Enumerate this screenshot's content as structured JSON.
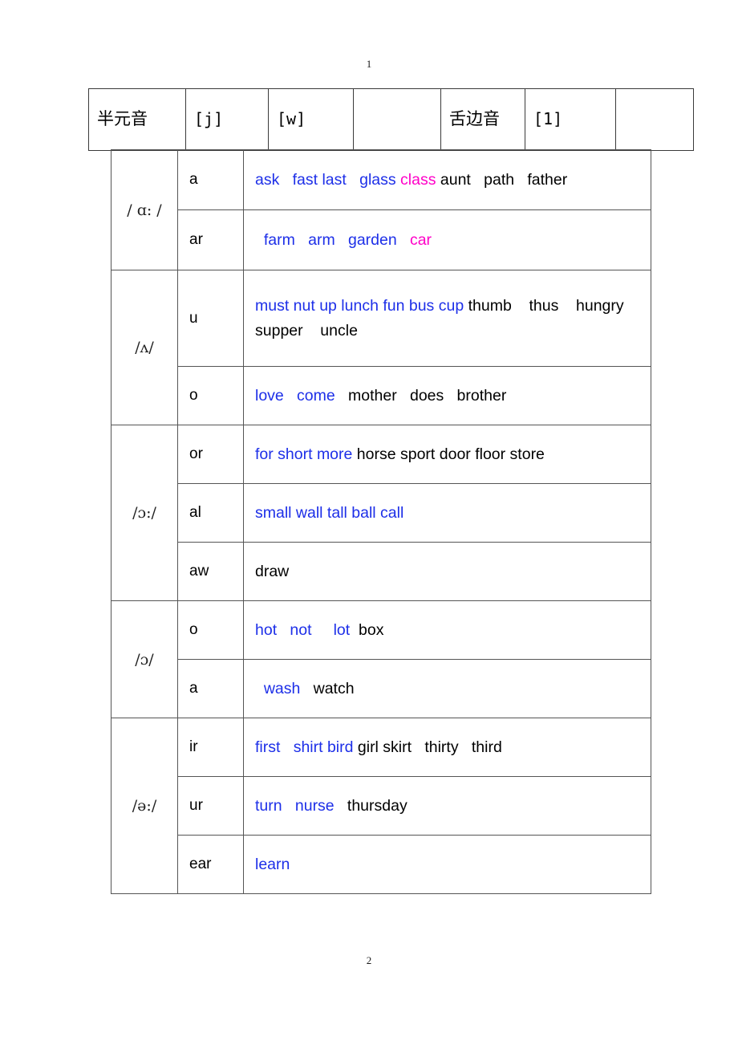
{
  "document": {
    "page_number_top": "1",
    "page_number_bottom": "2"
  },
  "colors": {
    "blue": "#1d2fe8",
    "magenta": "#ff00c8",
    "black": "#000000",
    "border": "#555555",
    "header_border": "#3a3a3a"
  },
  "consonant_header": {
    "cells": [
      {
        "text": "半元音",
        "style": "cjk"
      },
      {
        "text": "[j]",
        "style": "ipa"
      },
      {
        "text": "[w]",
        "style": "ipa"
      },
      {
        "text": "",
        "style": "blank"
      },
      {
        "text": "舌边音",
        "style": "cjk"
      },
      {
        "text": "[1]",
        "style": "ipa"
      },
      {
        "text": "",
        "style": "blank"
      }
    ]
  },
  "vowel_table": {
    "groups": [
      {
        "ipa": "/ ɑ: /",
        "rows": [
          {
            "spelling": "a",
            "words": [
              {
                "text": "ask",
                "color": "blue"
              },
              {
                "text": "   ",
                "color": "black"
              },
              {
                "text": "fast last",
                "color": "blue"
              },
              {
                "text": "   ",
                "color": "black"
              },
              {
                "text": "glass ",
                "color": "blue"
              },
              {
                "text": "class",
                "color": "magenta"
              },
              {
                "text": " aunt",
                "color": "black"
              },
              {
                "text": "   ",
                "color": "black"
              },
              {
                "text": "path",
                "color": "black"
              },
              {
                "text": "   ",
                "color": "black"
              },
              {
                "text": "father",
                "color": "black"
              }
            ]
          },
          {
            "spelling": "ar",
            "words": [
              {
                "text": "  farm",
                "color": "blue"
              },
              {
                "text": "   ",
                "color": "black"
              },
              {
                "text": "arm",
                "color": "blue"
              },
              {
                "text": "   ",
                "color": "black"
              },
              {
                "text": "garden",
                "color": "blue"
              },
              {
                "text": "   ",
                "color": "black"
              },
              {
                "text": "car",
                "color": "magenta"
              }
            ]
          }
        ]
      },
      {
        "ipa": "/ʌ/",
        "rows": [
          {
            "spelling": "u",
            "words": [
              {
                "text": "must nut up lunch fun bus cup",
                "color": "blue"
              },
              {
                "text": " thumb",
                "color": "black"
              },
              {
                "text": "    ",
                "color": "black"
              },
              {
                "text": "thus",
                "color": "black"
              },
              {
                "text": "    ",
                "color": "black"
              },
              {
                "text": "hungry",
                "color": "black"
              },
              {
                "text": "\n",
                "color": "black"
              },
              {
                "text": "supper",
                "color": "black"
              },
              {
                "text": "    ",
                "color": "black"
              },
              {
                "text": "uncle",
                "color": "black"
              }
            ]
          },
          {
            "spelling": "o",
            "words": [
              {
                "text": "love",
                "color": "blue"
              },
              {
                "text": "   ",
                "color": "black"
              },
              {
                "text": "come",
                "color": "blue"
              },
              {
                "text": "   ",
                "color": "black"
              },
              {
                "text": "mother",
                "color": "black"
              },
              {
                "text": "   ",
                "color": "black"
              },
              {
                "text": "does",
                "color": "black"
              },
              {
                "text": "   ",
                "color": "black"
              },
              {
                "text": "brother",
                "color": "black"
              }
            ]
          }
        ]
      },
      {
        "ipa": "/ɔ:/",
        "rows": [
          {
            "spelling": "or",
            "words": [
              {
                "text": "for short more",
                "color": "blue"
              },
              {
                "text": " horse sport door floor store",
                "color": "black"
              }
            ]
          },
          {
            "spelling": "al",
            "words": [
              {
                "text": "small wall tall ball call",
                "color": "blue"
              }
            ]
          },
          {
            "spelling": "aw",
            "words": [
              {
                "text": "draw",
                "color": "black"
              }
            ]
          }
        ]
      },
      {
        "ipa": "/ɔ/",
        "rows": [
          {
            "spelling": "o",
            "words": [
              {
                "text": "hot",
                "color": "blue"
              },
              {
                "text": "   ",
                "color": "black"
              },
              {
                "text": "not",
                "color": "blue"
              },
              {
                "text": "     ",
                "color": "black"
              },
              {
                "text": "lot",
                "color": "blue"
              },
              {
                "text": "  ",
                "color": "black"
              },
              {
                "text": "box",
                "color": "black"
              }
            ]
          },
          {
            "spelling": "a",
            "words": [
              {
                "text": "  wash",
                "color": "blue"
              },
              {
                "text": "   ",
                "color": "black"
              },
              {
                "text": "watch",
                "color": "black"
              }
            ]
          }
        ]
      },
      {
        "ipa": "/ə:/",
        "rows": [
          {
            "spelling": "ir",
            "words": [
              {
                "text": "first",
                "color": "blue"
              },
              {
                "text": "   ",
                "color": "black"
              },
              {
                "text": "shirt bird",
                "color": "blue"
              },
              {
                "text": " girl skirt",
                "color": "black"
              },
              {
                "text": "   ",
                "color": "black"
              },
              {
                "text": "thirty",
                "color": "black"
              },
              {
                "text": "   ",
                "color": "black"
              },
              {
                "text": "third",
                "color": "black"
              }
            ]
          },
          {
            "spelling": "ur",
            "words": [
              {
                "text": "turn",
                "color": "blue"
              },
              {
                "text": "   ",
                "color": "black"
              },
              {
                "text": "nurse",
                "color": "blue"
              },
              {
                "text": "   ",
                "color": "black"
              },
              {
                "text": "thursday",
                "color": "black"
              }
            ]
          },
          {
            "spelling": "ear",
            "words": [
              {
                "text": "learn",
                "color": "blue"
              }
            ]
          }
        ]
      }
    ]
  }
}
